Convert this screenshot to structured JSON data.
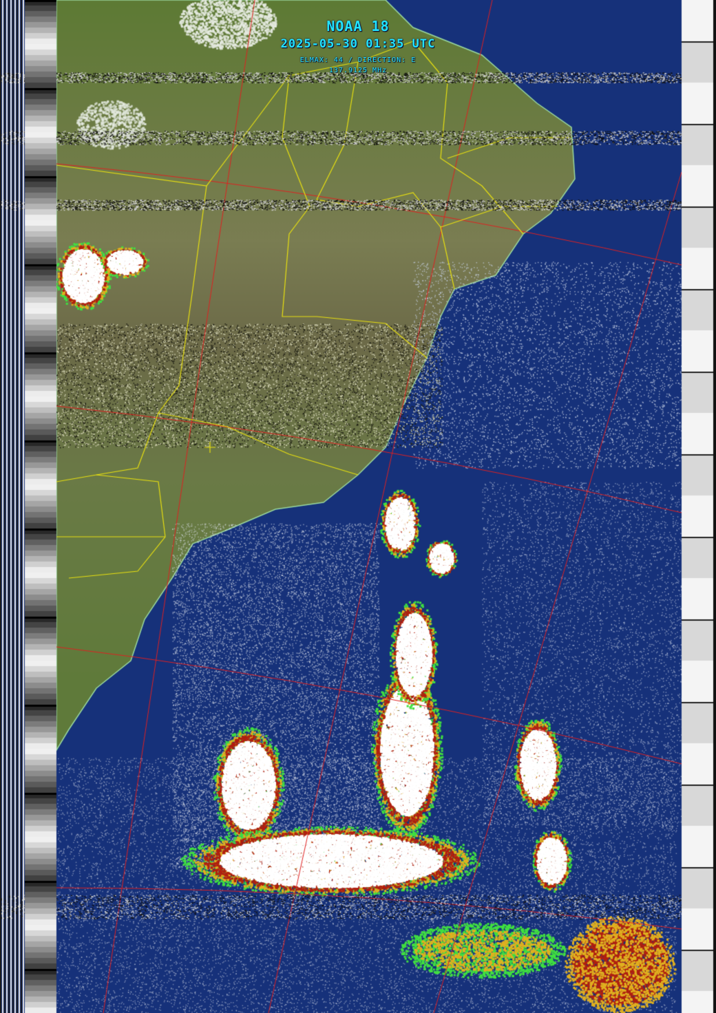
{
  "header": {
    "satellite": "NOAA 18",
    "timestamp": "2025-05-30 01:35 UTC",
    "elevation": "ELMAX: 44 / DIRECTION: E",
    "frequency": "137.9125 MHz"
  },
  "image": {
    "description_kind": "APT weather satellite image, MCIR/thermal colored composite",
    "colors": {
      "ocean": "#16317a",
      "land": "#6f7c4a",
      "land_north": "#5d7a34",
      "cloud_white": "#ffffff",
      "cloud_warm": "#e0b020",
      "cloud_hot": "#b02010",
      "cloud_green": "#40e040",
      "border_yellow": "#e8e010",
      "grid_red": "#e02020",
      "text_cyan": "#22e4ff"
    }
  }
}
